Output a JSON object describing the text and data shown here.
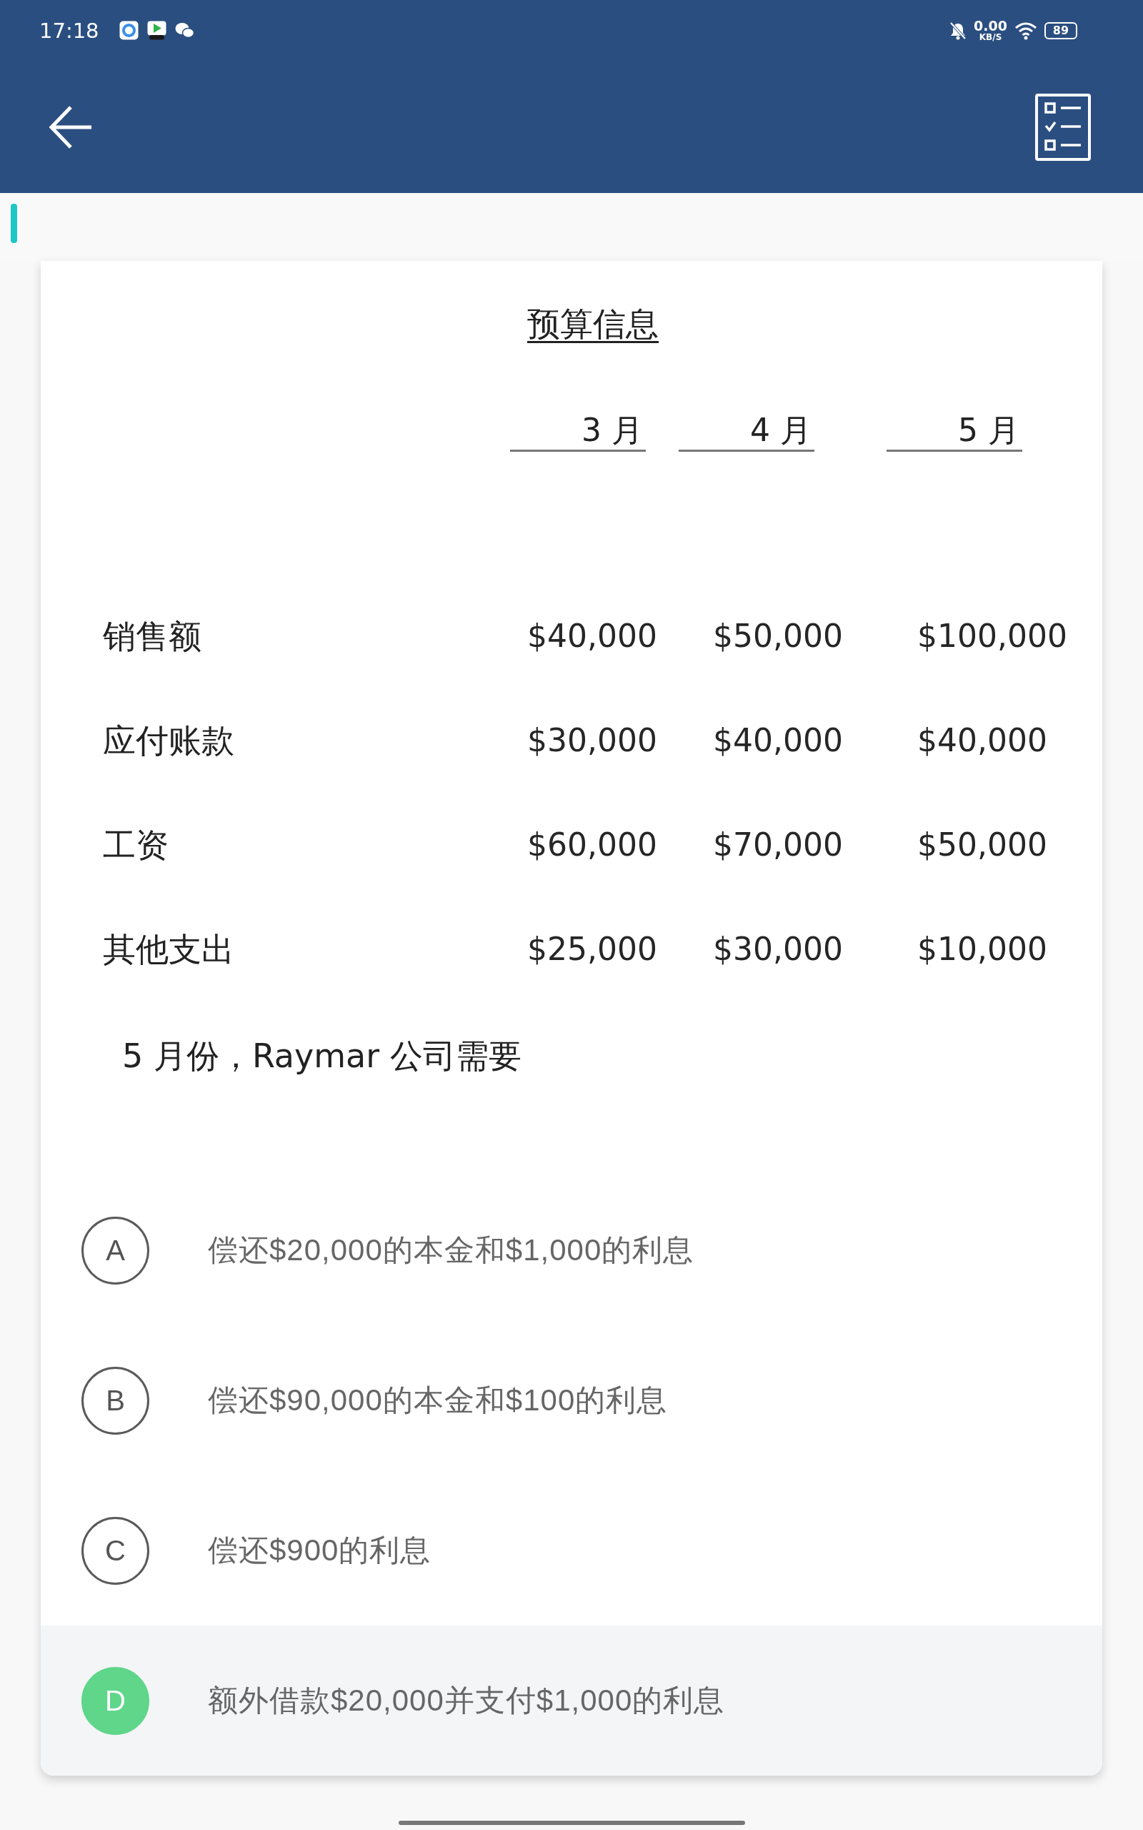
{
  "status_bar": {
    "time": "17:18",
    "speed_value": "0.00",
    "speed_unit": "KB/S",
    "battery": "89"
  },
  "question": {
    "title": "预算信息",
    "columns": [
      "3 月",
      "4 月",
      "5 月"
    ],
    "rows": [
      {
        "label": "销售额",
        "values": [
          "$40,000",
          "$50,000",
          "$100,000"
        ]
      },
      {
        "label": "应付账款",
        "values": [
          "$30,000",
          "$40,000",
          "$40,000"
        ]
      },
      {
        "label": "工资",
        "values": [
          "$60,000",
          "$70,000",
          "$50,000"
        ]
      },
      {
        "label": "其他支出",
        "values": [
          "$25,000",
          "$30,000",
          "$10,000"
        ]
      }
    ],
    "prompt": "5 月份，Raymar 公司需要"
  },
  "options": [
    {
      "letter": "A",
      "text": "偿还$20,000的本金和$1,000的利息",
      "selected": false
    },
    {
      "letter": "B",
      "text": "偿还$90,000的本金和$100的利息",
      "selected": false
    },
    {
      "letter": "C",
      "text": "偿还$900的利息",
      "selected": false
    },
    {
      "letter": "D",
      "text": "额外借款$20,000并支付$1,000的利息",
      "selected": true
    }
  ]
}
